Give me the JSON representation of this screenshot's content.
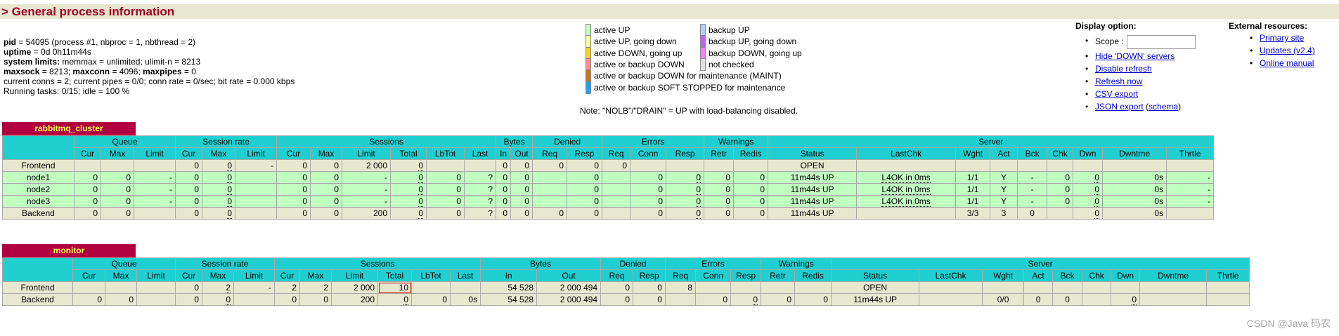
{
  "page": {
    "title": "> General process information"
  },
  "process": {
    "pid_label": "pid",
    "pid_value": " = 54095 (process #1, nbproc = 1, nbthread = 2)",
    "uptime_label": "uptime",
    "uptime_value": " = 0d 0h11m44s",
    "syslimits_label": "system limits:",
    "syslimits_value": " memmax = unlimited; ulimit-n = 8213",
    "maxsock_label": "maxsock",
    "maxsock_value": " = 8213; ",
    "maxconn_label": "maxconn",
    "maxconn_value": " = 4096; ",
    "maxpipes_label": "maxpipes",
    "maxpipes_value": " = 0",
    "current": "current conns = 2; current pipes = 0/0; conn rate = 0/sec; bit rate = 0.000 kbps",
    "tasks": "Running tasks: 0/15; idle = 100 %"
  },
  "legend": {
    "items": [
      {
        "label": "active UP",
        "color": "#c0ffc0"
      },
      {
        "label": "active UP, going down",
        "color": "#ffffa0"
      },
      {
        "label": "active DOWN, going up",
        "color": "#ffd020"
      },
      {
        "label": "active or backup DOWN",
        "color": "#ff9090"
      },
      {
        "label": "active or backup DOWN for maintenance (MAINT)",
        "color": "#c07820"
      },
      {
        "label": "active or backup SOFT STOPPED for maintenance",
        "color": "#20a0ff"
      }
    ],
    "items_right": [
      {
        "label": "backup UP",
        "color": "#b0d0ff"
      },
      {
        "label": "backup UP, going down",
        "color": "#c060ff"
      },
      {
        "label": "backup DOWN, going up",
        "color": "#ff80ff"
      },
      {
        "label": "not checked",
        "color": "#e0e0e0"
      }
    ],
    "note": "Note: \"NOLB\"/\"DRAIN\" = UP with load-balancing disabled."
  },
  "display_options": {
    "heading": "Display option:",
    "scope_label": "Scope :",
    "scope_value": "",
    "links": [
      "Hide 'DOWN' servers",
      "Disable refresh",
      "Refresh now",
      "CSV export",
      "JSON export"
    ],
    "schema_open": " (",
    "schema_link": "schema",
    "schema_close": ")"
  },
  "external_resources": {
    "heading": "External resources:",
    "links": [
      "Primary site",
      "Updates (v2.4)",
      "Online manual"
    ]
  },
  "headers": {
    "groups": [
      "Queue",
      "Session rate",
      "Sessions",
      "Bytes",
      "Denied",
      "Errors",
      "Warnings",
      "Server"
    ],
    "cols": [
      "Cur",
      "Max",
      "Limit",
      "Cur",
      "Max",
      "Limit",
      "Cur",
      "Max",
      "Limit",
      "Total",
      "LbTot",
      "Last",
      "In",
      "Out",
      "Req",
      "Resp",
      "Req",
      "Conn",
      "Resp",
      "Retr",
      "Redis",
      "Status",
      "LastChk",
      "Wght",
      "Act",
      "Bck",
      "Chk",
      "Dwn",
      "Dwntme",
      "Thrtle"
    ]
  },
  "proxies": [
    {
      "name": "rabbitmq_cluster",
      "rows": [
        {
          "kind": "front",
          "cells": [
            "Frontend",
            "",
            "",
            "",
            "0",
            "0",
            "-",
            "0",
            "0",
            "2 000",
            "0",
            "",
            "",
            "0",
            "0",
            "0",
            "0",
            "0",
            "",
            "",
            "",
            "",
            "OPEN",
            "",
            "",
            "",
            "",
            "",
            "",
            "",
            ""
          ]
        },
        {
          "kind": "up",
          "cells": [
            "node1",
            "0",
            "0",
            "-",
            "0",
            "0",
            "",
            "0",
            "0",
            "-",
            "0",
            "0",
            "?",
            "0",
            "0",
            "",
            "0",
            "",
            "0",
            "0",
            "0",
            "0",
            "11m44s UP",
            "L4OK in 0ms",
            "1/1",
            "Y",
            "-",
            "0",
            "0",
            "0s",
            "-"
          ]
        },
        {
          "kind": "up",
          "cells": [
            "node2",
            "0",
            "0",
            "-",
            "0",
            "0",
            "",
            "0",
            "0",
            "-",
            "0",
            "0",
            "?",
            "0",
            "0",
            "",
            "0",
            "",
            "0",
            "0",
            "0",
            "0",
            "11m44s UP",
            "L4OK in 0ms",
            "1/1",
            "Y",
            "-",
            "0",
            "0",
            "0s",
            "-"
          ]
        },
        {
          "kind": "up",
          "cells": [
            "node3",
            "0",
            "0",
            "-",
            "0",
            "0",
            "",
            "0",
            "0",
            "-",
            "0",
            "0",
            "?",
            "0",
            "0",
            "",
            "0",
            "",
            "0",
            "0",
            "0",
            "0",
            "11m44s UP",
            "L4OK in 0ms",
            "1/1",
            "Y",
            "-",
            "0",
            "0",
            "0s",
            "-"
          ]
        },
        {
          "kind": "back",
          "cells": [
            "Backend",
            "0",
            "0",
            "",
            "0",
            "0",
            "",
            "0",
            "0",
            "200",
            "0",
            "0",
            "?",
            "0",
            "0",
            "0",
            "0",
            "",
            "0",
            "0",
            "0",
            "0",
            "11m44s UP",
            "",
            "3/3",
            "3",
            "0",
            "",
            "0",
            "0s",
            ""
          ]
        }
      ]
    },
    {
      "name": "monitor",
      "rows": [
        {
          "kind": "front",
          "cells": [
            "Frontend",
            "",
            "",
            "",
            "0",
            "2",
            "-",
            "2",
            "2",
            "2 000",
            "10",
            "",
            "",
            "54 528",
            "2 000 494",
            "0",
            "0",
            "8",
            "",
            "",
            "",
            "",
            "OPEN",
            "",
            "",
            "",
            "",
            "",
            "",
            "",
            ""
          ]
        },
        {
          "kind": "back",
          "cells": [
            "Backend",
            "0",
            "0",
            "",
            "0",
            "0",
            "",
            "0",
            "0",
            "200",
            "0",
            "0",
            "0s",
            "54 528",
            "2 000 494",
            "0",
            "0",
            "",
            "0",
            "0",
            "0",
            "0",
            "11m44s UP",
            "",
            "0/0",
            "0",
            "0",
            "",
            "0",
            "",
            ""
          ]
        }
      ]
    }
  ],
  "watermark": "CSDN @Java 码农"
}
